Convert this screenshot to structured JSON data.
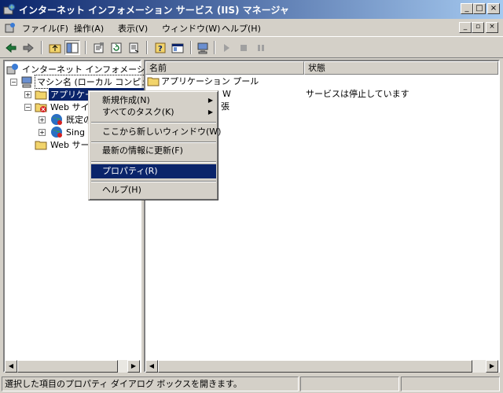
{
  "window": {
    "title": "インターネット インフォメーション サービス (IIS) マネージャ",
    "buttons": {
      "minimize": "_",
      "maximize": "□",
      "close": "×"
    }
  },
  "menubar": {
    "items": [
      "ファイル(F)",
      "操作(A)",
      "表示(V)",
      "ウィンドウ(W)",
      "ヘルプ(H)"
    ],
    "mdi_buttons": {
      "minimize": "_",
      "restore": "▫",
      "close": "×"
    }
  },
  "toolbar": {
    "icons": [
      "back-arrow-icon",
      "forward-arrow-icon",
      "up-folder-icon",
      "show-tree-icon",
      "properties-icon",
      "refresh-icon",
      "export-list-icon",
      "help-icon",
      "mmc-window-icon",
      "computer-icon",
      "play-icon",
      "stop-icon",
      "pause-icon"
    ]
  },
  "tree": {
    "root": "インターネット インフォメーション",
    "machine": "マシン名 (ローカル コンピュ",
    "app_pools": "アプリケーション プール",
    "web_sites": "Web サイ",
    "default_site": "既定の",
    "single_site": "Sing",
    "web_service_ext": "Web サー"
  },
  "list": {
    "columns": [
      "名前",
      "状態"
    ],
    "rows": [
      {
        "name": "アプリケーション プール",
        "status": ""
      },
      {
        "name": "Web サイト",
        "status": "サービスは停止しています"
      },
      {
        "name": "Web サービス拡張",
        "status": ""
      }
    ],
    "partial_texts": [
      "W",
      "張"
    ]
  },
  "context_menu": {
    "items": [
      {
        "label": "新規作成(N)",
        "submenu": true
      },
      {
        "label": "すべてのタスク(K)",
        "submenu": true
      },
      {
        "label": "ここから新しいウィンドウ(W)",
        "submenu": false
      },
      {
        "label": "最新の情報に更新(F)",
        "submenu": false
      },
      {
        "label": "プロパティ(R)",
        "submenu": false,
        "highlighted": true
      },
      {
        "label": "ヘルプ(H)",
        "submenu": false
      }
    ]
  },
  "statusbar": {
    "text": "選択した項目のプロパティ ダイアログ ボックスを開きます。"
  },
  "colors": {
    "title_start": "#0a246a",
    "title_end": "#a6caf0",
    "selection": "#0a246a",
    "face": "#d4d0c8"
  }
}
